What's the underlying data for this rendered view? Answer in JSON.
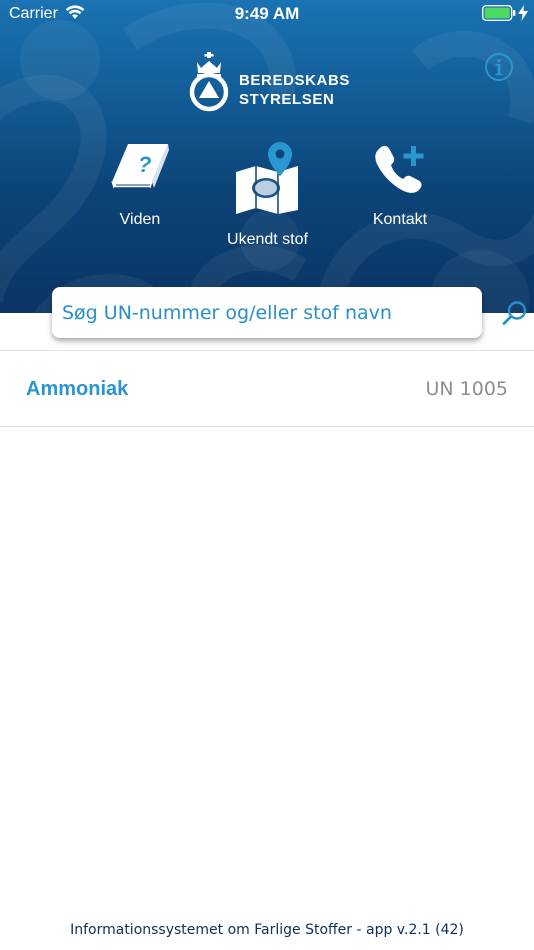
{
  "status_bar": {
    "carrier": "Carrier",
    "time": "9:49 AM"
  },
  "header": {
    "logo_line1": "BEREDSKABS",
    "logo_line2": "STYRELSEN",
    "nav": [
      {
        "label": "Viden",
        "icon": "book-question-icon"
      },
      {
        "label": "Ukendt stof",
        "icon": "map-pin-icon"
      },
      {
        "label": "Kontakt",
        "icon": "phone-plus-icon"
      }
    ],
    "info_icon": "info-icon"
  },
  "search": {
    "placeholder": "Søg UN-nummer og/eller stof navn",
    "value": ""
  },
  "results": [
    {
      "name": "Ammoniak",
      "un": "UN 1005"
    }
  ],
  "footer": {
    "text": "Informationssystemet om Farlige Stoffer - app v.2.1 (42)"
  },
  "colors": {
    "header_top": "#1a73b3",
    "header_bottom": "#0a3464",
    "accent": "#2a96cf",
    "muted": "#8e8e8e"
  }
}
